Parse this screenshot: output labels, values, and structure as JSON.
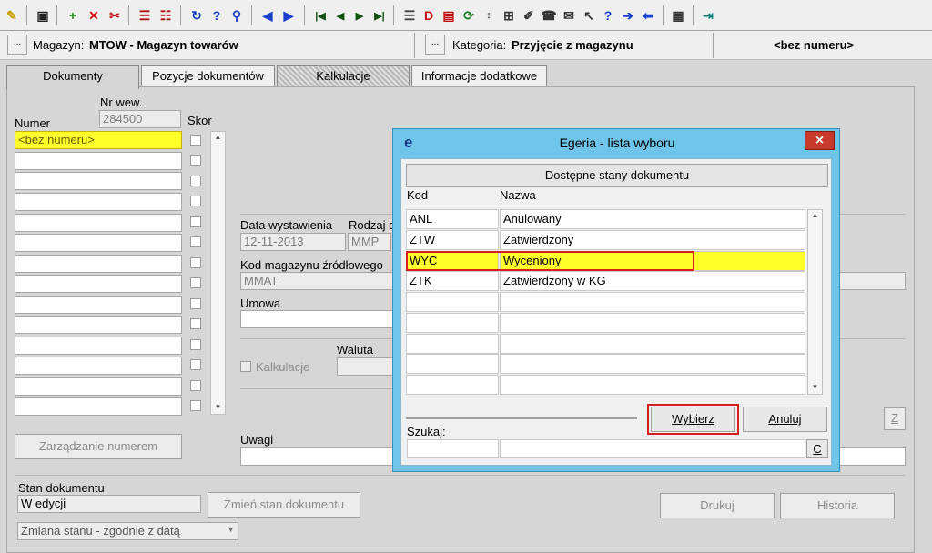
{
  "toolbar": {
    "icons": [
      "pin-icon",
      "save-icon",
      "add-icon",
      "delete-icon",
      "clear-icon",
      "split-icon",
      "split2-icon",
      "refresh-icon",
      "help-question-icon",
      "find-icon",
      "back-arrow-icon",
      "forward-arrow-icon",
      "first-icon",
      "prev-icon",
      "next-icon",
      "last-icon",
      "list-icon",
      "document-icon",
      "sync-icon",
      "sort-icon",
      "tree-icon",
      "edit-icon",
      "phone-icon",
      "mail-icon",
      "pointer-help-icon",
      "question-icon",
      "arrow-right-icon",
      "arrow-left-icon",
      "print-preview-icon",
      "exit-icon"
    ]
  },
  "infobar": {
    "magazyn_label": "Magazyn:",
    "magazyn_value": "MTOW - Magazyn towarów",
    "kategoria_label": "Kategoria:",
    "kategoria_value": "Przyjęcie z magazynu",
    "numer": "<bez numeru>",
    "ellipsis": "..."
  },
  "tabs": [
    "Dokumenty",
    "Pozycje dokumentów",
    "Kalkulacje",
    "Informacje dodatkowe"
  ],
  "left": {
    "nr_wew_label": "Nr wew.",
    "nr_wew_value": "284500",
    "numer_label": "Numer",
    "skor_label": "Skor",
    "first_row": "<bez numeru>",
    "manage_btn": "Zarządzanie numerem"
  },
  "form": {
    "data_label": "Data wystawienia",
    "data_value": "12-11-2013",
    "rodzaj_label": "Rodzaj d",
    "rodzaj_value": "MMP",
    "kod_label": "Kod magazynu źródłowego",
    "kod_value": "MMAT",
    "umowa_label": "Umowa",
    "waluta_label": "Waluta",
    "kalkulacje_label": "Kalkulacje",
    "uwagi_label": "Uwagi",
    "z_btn": "Z"
  },
  "bottom": {
    "stan_label": "Stan dokumentu",
    "stan_value": "W edycji",
    "zmien_btn": "Zmień stan dokumentu",
    "zmiana_select": "Zmiana stanu - zgodnie z datą",
    "drukuj_btn": "Drukuj",
    "historia_btn": "Historia"
  },
  "dialog": {
    "title": "Egeria - lista wyboru",
    "header_btn": "Dostępne stany dokumentu",
    "col_kod": "Kod",
    "col_nazwa": "Nazwa",
    "rows": [
      {
        "kod": "ANL",
        "nazwa": "Anulowany"
      },
      {
        "kod": "ZTW",
        "nazwa": "Zatwierdzony"
      },
      {
        "kod": "WYC",
        "nazwa": "Wyceniony"
      },
      {
        "kod": "ZTK",
        "nazwa": "Zatwierdzony w KG"
      }
    ],
    "wybierz": "Wybierz",
    "anuluj": "Anuluj",
    "szukaj_label": "Szukaj:",
    "clear_btn": "C",
    "close": "×",
    "logo": "e"
  },
  "colors": {
    "selection": "#ffff2a",
    "dialog_frame": "#6fc4ea",
    "highlight_border": "#d62020"
  }
}
